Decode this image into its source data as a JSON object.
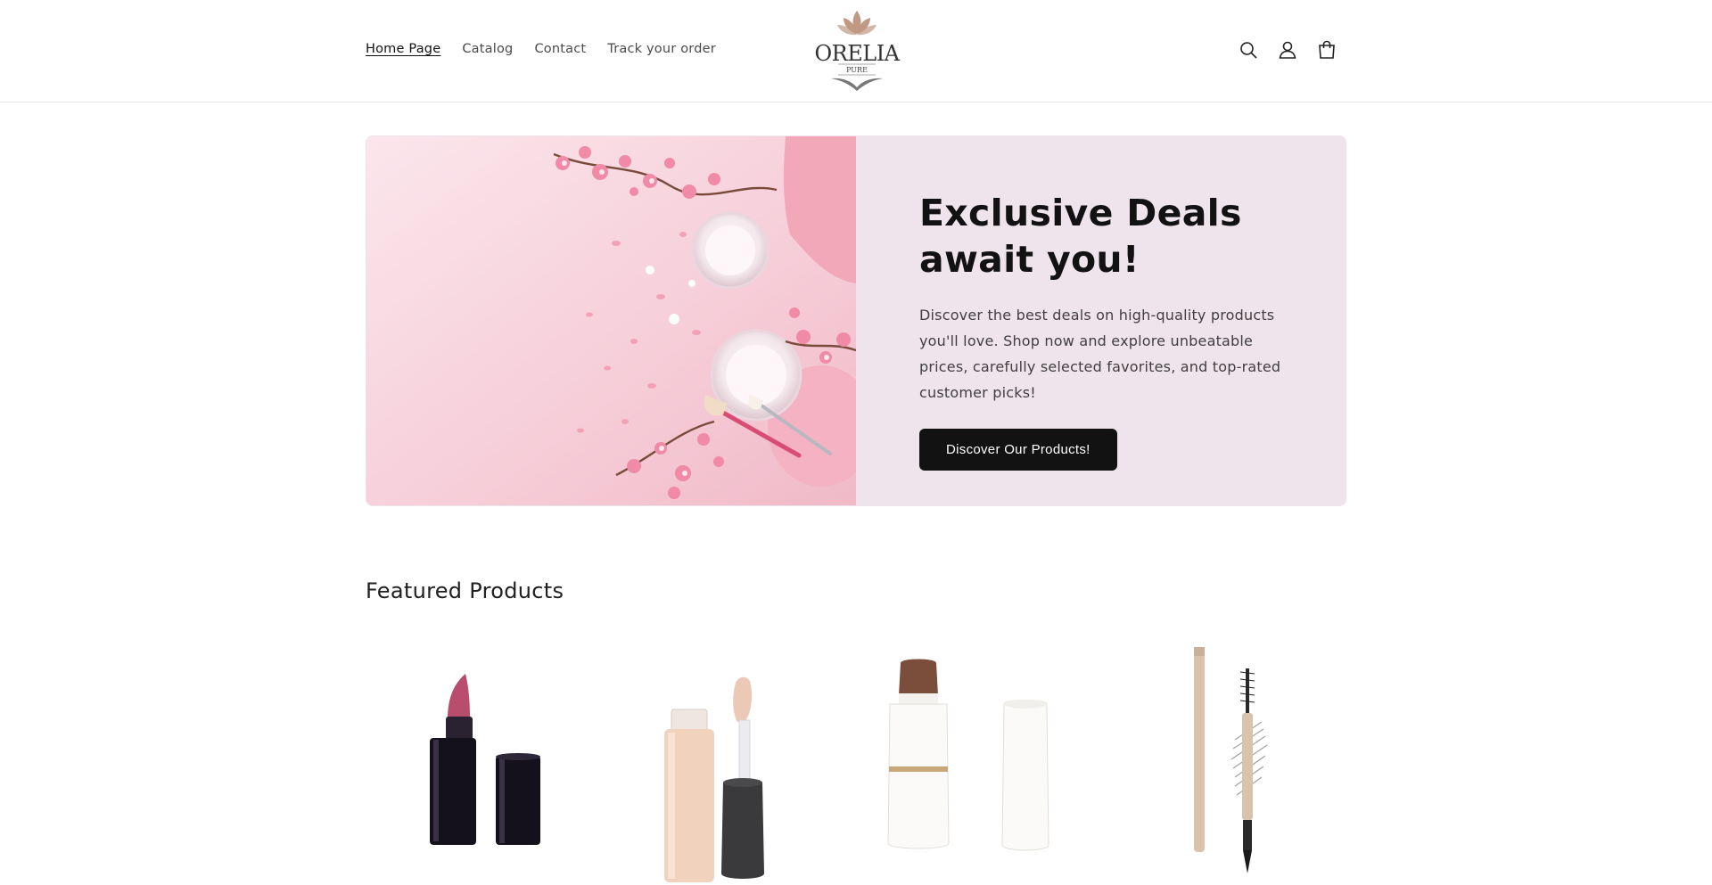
{
  "header": {
    "nav": [
      "Home Page",
      "Catalog",
      "Contact",
      "Track your order"
    ],
    "logo": {
      "name": "ORELIA",
      "sub": "PURE"
    },
    "icons": [
      "search-icon",
      "account-icon",
      "cart-icon"
    ]
  },
  "hero": {
    "title": "Exclusive Deals await you!",
    "description": "Discover the best deals on high-quality products you'll love. Shop now and explore unbeatable prices, carefully selected favorites, and top-rated customer picks!",
    "button_label": "Discover Our Products!",
    "colors": {
      "panel": "#efe4ec",
      "button": "#121212",
      "image_bg": "#f6d6df"
    }
  },
  "featured": {
    "title": "Featured Products",
    "products": [
      {
        "icon": "lipstick-icon"
      },
      {
        "icon": "concealer-icon"
      },
      {
        "icon": "foundation-stick-icon"
      },
      {
        "icon": "brow-pencil-icon"
      }
    ]
  }
}
